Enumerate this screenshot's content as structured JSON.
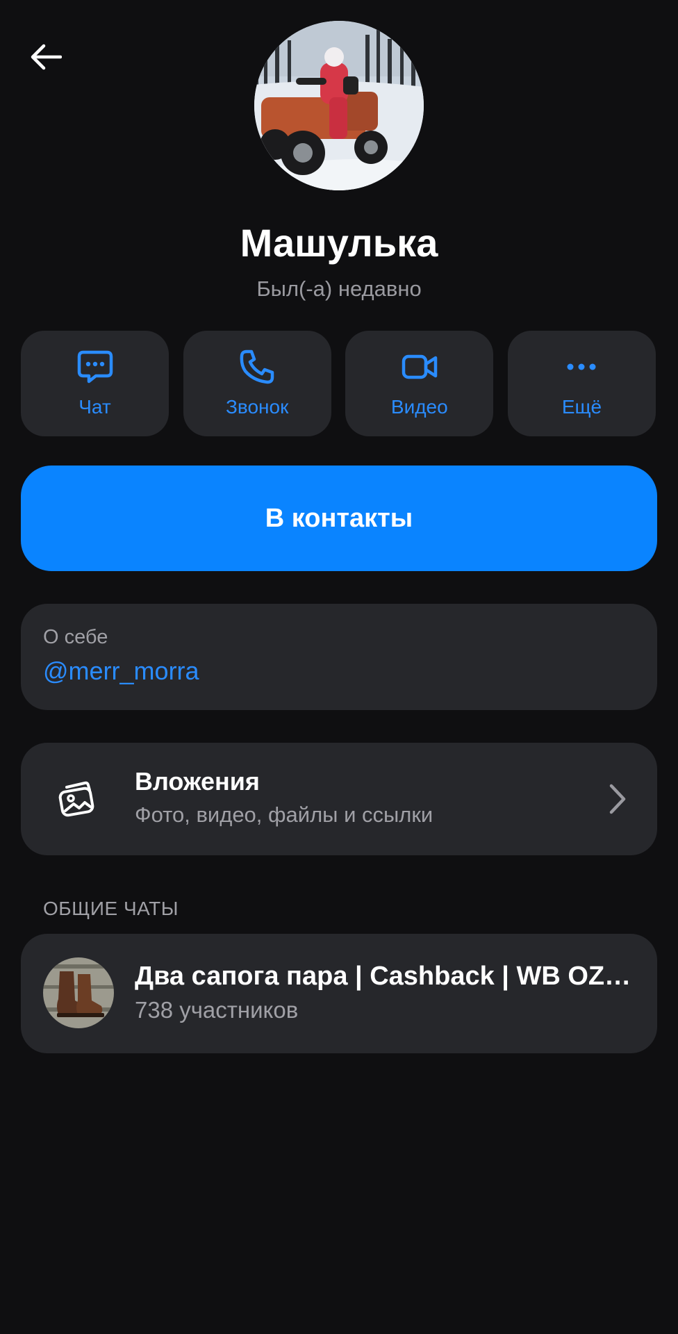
{
  "profile": {
    "name": "Машулька",
    "status": "Был(-а) недавно"
  },
  "actions": [
    {
      "label": "Чат",
      "icon": "chat-bubble-icon"
    },
    {
      "label": "Звонок",
      "icon": "phone-icon"
    },
    {
      "label": "Видео",
      "icon": "video-camera-icon"
    },
    {
      "label": "Ещё",
      "icon": "more-dots-icon"
    }
  ],
  "add_contact_label": "В контакты",
  "about": {
    "title": "О себе",
    "value": "@merr_morra"
  },
  "attachments": {
    "title": "Вложения",
    "subtitle": "Фото, видео, файлы и ссылки"
  },
  "common_chats": {
    "section_label": "ОБЩИЕ ЧАТЫ",
    "items": [
      {
        "title": "Два сапога пара | Cashback | WB OZON",
        "subtitle": "738 участников"
      }
    ]
  },
  "colors": {
    "background": "#0f0f11",
    "card": "#26272b",
    "accent": "#0a84ff",
    "link": "#2a8cff",
    "muted_text": "#a0a0a6"
  }
}
